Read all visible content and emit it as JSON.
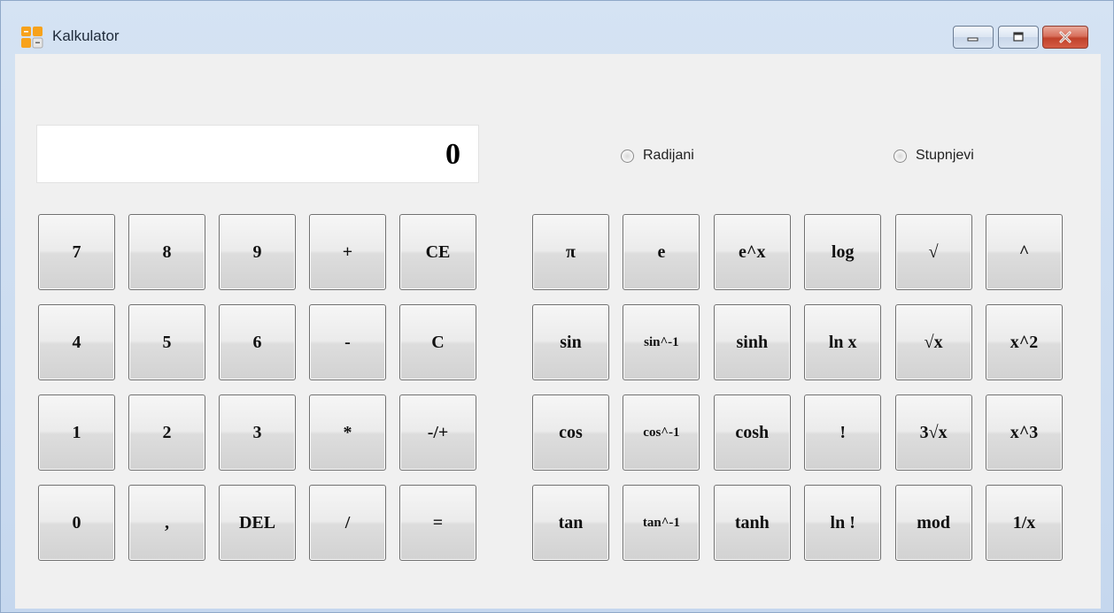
{
  "window": {
    "title": "Kalkulator",
    "controls": {
      "minimize": "minimize-icon",
      "maximize": "maximize-icon",
      "close": "close-icon"
    }
  },
  "display": {
    "value": "0"
  },
  "angle_mode": {
    "options": [
      "Radijani",
      "Stupnjevi"
    ],
    "selected": null
  },
  "basic_keys": [
    [
      "7",
      "8",
      "9",
      "+",
      "CE"
    ],
    [
      "4",
      "5",
      "6",
      "-",
      "C"
    ],
    [
      "1",
      "2",
      "3",
      "*",
      "-/+"
    ],
    [
      "0",
      ",",
      "DEL",
      "/",
      "="
    ]
  ],
  "scientific_keys": [
    [
      "π",
      "e",
      "e^x",
      "log",
      "√",
      "^"
    ],
    [
      "sin",
      "sin^-1",
      "sinh",
      "ln x",
      "√x",
      "x^2"
    ],
    [
      "cos",
      "cos^-1",
      "cosh",
      "!",
      "3√x",
      "x^3"
    ],
    [
      "tan",
      "tan^-1",
      "tanh",
      "ln !",
      "mod",
      "1/x"
    ]
  ],
  "colors": {
    "accent": "#c0422b",
    "frame": "#c5d7ee",
    "client": "#f0f0f0"
  }
}
